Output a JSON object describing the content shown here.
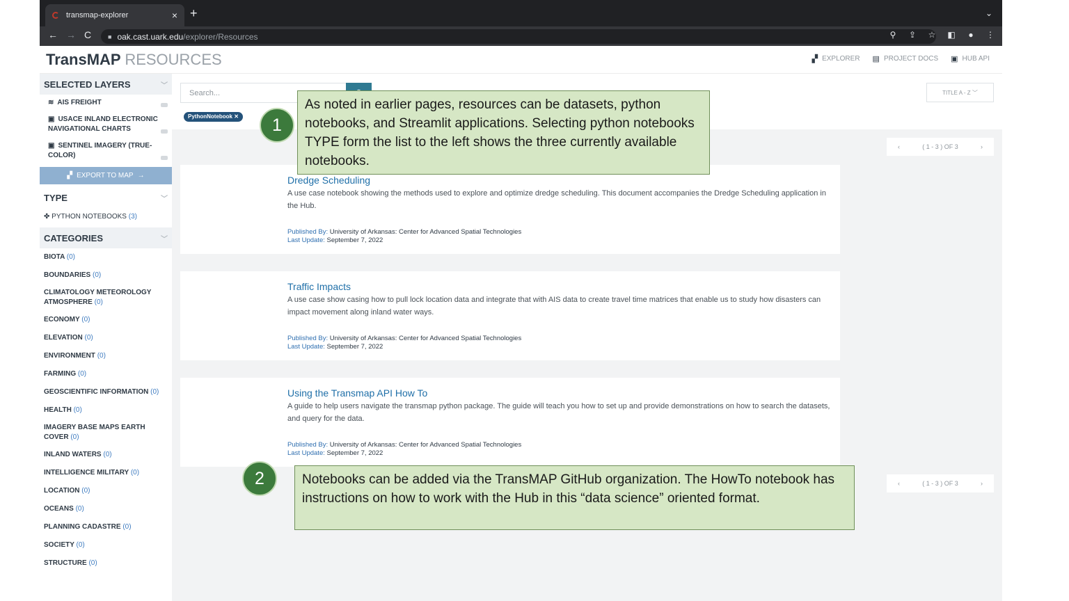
{
  "browser": {
    "tab_title": "transmap-explorer",
    "tab_close": "×",
    "new_tab": "+",
    "url_host": "oak.cast.uark.edu",
    "url_path": "/explorer/Resources"
  },
  "header": {
    "brand_main": "TransMAP",
    "brand_sub": "RESOURCES",
    "nav": [
      {
        "label": "EXPLORER",
        "icon": "map-icon"
      },
      {
        "label": "PROJECT DOCS",
        "icon": "book-icon"
      },
      {
        "label": "HUB API",
        "icon": "chip-icon"
      }
    ]
  },
  "sidebar": {
    "selected_layers_title": "SELECTED LAYERS",
    "layers": [
      {
        "label": "AIS FREIGHT",
        "icon": "layers-icon"
      },
      {
        "label": "USACE INLAND ELECTRONIC NAVIGATIONAL CHARTS",
        "icon": "image-icon"
      },
      {
        "label": "SENTINEL IMAGERY (TRUE-COLOR)",
        "icon": "image-icon"
      }
    ],
    "export_label": "EXPORT TO MAP",
    "type_title": "TYPE",
    "types": [
      {
        "label": "PYTHON NOTEBOOKS",
        "count": "(3)"
      }
    ],
    "categories_title": "CATEGORIES",
    "categories": [
      {
        "label": "BIOTA",
        "count": "(0)"
      },
      {
        "label": "BOUNDARIES",
        "count": "(0)"
      },
      {
        "label": "CLIMATOLOGY METEOROLOGY ATMOSPHERE",
        "count": "(0)"
      },
      {
        "label": "ECONOMY",
        "count": "(0)"
      },
      {
        "label": "ELEVATION",
        "count": "(0)"
      },
      {
        "label": "ENVIRONMENT",
        "count": "(0)"
      },
      {
        "label": "FARMING",
        "count": "(0)"
      },
      {
        "label": "GEOSCIENTIFIC INFORMATION",
        "count": "(0)"
      },
      {
        "label": "HEALTH",
        "count": "(0)"
      },
      {
        "label": "IMAGERY BASE MAPS EARTH COVER",
        "count": "(0)"
      },
      {
        "label": "INLAND WATERS",
        "count": "(0)"
      },
      {
        "label": "INTELLIGENCE MILITARY",
        "count": "(0)"
      },
      {
        "label": "LOCATION",
        "count": "(0)"
      },
      {
        "label": "OCEANS",
        "count": "(0)"
      },
      {
        "label": "PLANNING CADASTRE",
        "count": "(0)"
      },
      {
        "label": "SOCIETY",
        "count": "(0)"
      },
      {
        "label": "STRUCTURE",
        "count": "(0)"
      }
    ]
  },
  "search": {
    "placeholder": "Search..."
  },
  "sort_label": "TITLE A - Z",
  "filter_chip": "PythonNotebook",
  "pager_text": "( 1 - 3 ) OF 3",
  "cards": [
    {
      "title": "Dredge Scheduling",
      "desc": "A use case notebook showing the methods used to explore and optimize dredge scheduling. This document accompanies the Dredge Scheduling application in the Hub.",
      "published_label": "Published By:",
      "publisher": "University of Arkansas: Center for Advanced Spatial Technologies",
      "updated_label": "Last Update:",
      "updated": "September 7, 2022"
    },
    {
      "title": "Traffic Impacts",
      "desc": "A use case show casing how to pull lock location data and integrate that with AIS data to create travel time matrices that enable us to study how disasters can impact movement along inland water ways.",
      "published_label": "Published By:",
      "publisher": "University of Arkansas: Center for Advanced Spatial Technologies",
      "updated_label": "Last Update:",
      "updated": "September 7, 2022"
    },
    {
      "title": "Using the Transmap API How To",
      "desc": "A guide to help users navigate the transmap python package. The guide will teach you how to set up and provide demonstrations on how to search the datasets, and query for the data.",
      "published_label": "Published By:",
      "publisher": "University of Arkansas: Center for Advanced Spatial Technologies",
      "updated_label": "Last Update:",
      "updated": "September 7, 2022"
    }
  ],
  "callouts": [
    {
      "number": "1",
      "text": "As noted in earlier pages, resources can be datasets, python notebooks, and Streamlit applications. Selecting python notebooks TYPE form the list to the left shows the three currently available notebooks."
    },
    {
      "number": "2",
      "text": "Notebooks can be added via the TransMAP GitHub organization. The HowTo notebook has instructions on how to work with the Hub in this “data science” oriented format."
    }
  ],
  "colors": {
    "accent": "#2f7a92",
    "link": "#1f6fa8",
    "callout_bg": "#d6e7c5",
    "badge": "#3c7a3c"
  }
}
